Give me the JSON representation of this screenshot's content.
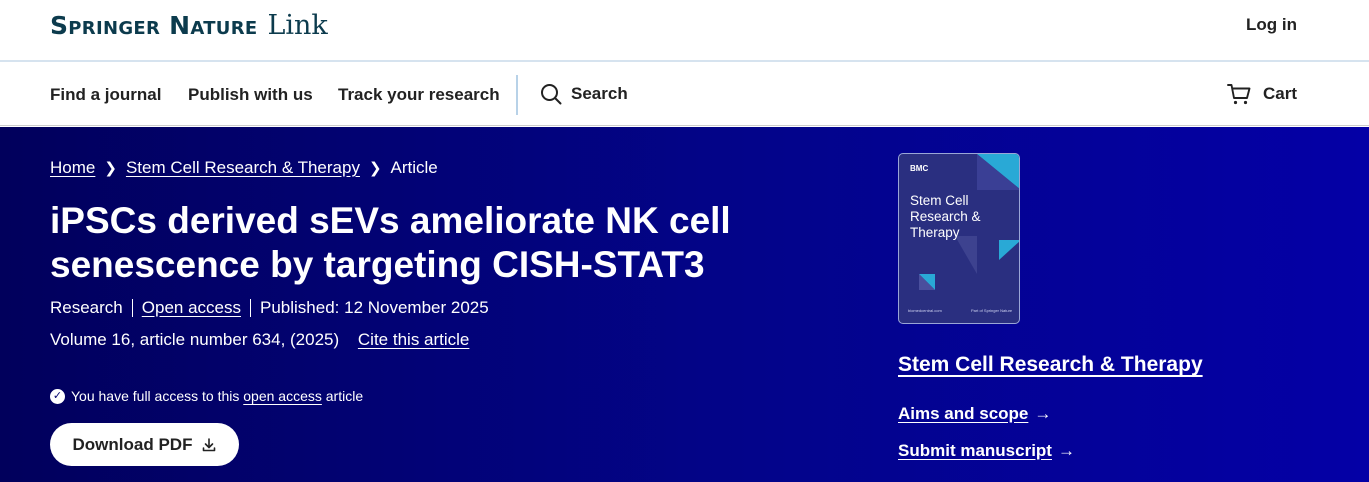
{
  "header": {
    "logo_brand": "Springer Nature",
    "logo_link": "Link",
    "login_label": "Log in"
  },
  "nav": {
    "items": [
      "Find a journal",
      "Publish with us",
      "Track your research"
    ],
    "search_label": "Search",
    "cart_label": "Cart"
  },
  "breadcrumb": {
    "home": "Home",
    "journal": "Stem Cell Research & Therapy",
    "current": "Article"
  },
  "article": {
    "title": "iPSCs derived sEVs ameliorate NK cell senescence by targeting CISH-STAT3",
    "type": "Research",
    "open_access": "Open access",
    "published": "Published: 12 November 2025",
    "volume_info": "Volume 16, article number 634, (2025)",
    "cite_label": "Cite this article",
    "access_prefix": "You have full access to this",
    "access_link": "open access",
    "access_suffix": "article",
    "download_label": "Download PDF"
  },
  "sidebar": {
    "cover": {
      "publisher": "BMC",
      "title": "Stem Cell Research & Therapy",
      "footer_left": "biomedcentral.com",
      "footer_right": "Part of Springer Nature"
    },
    "journal_name": "Stem Cell Research & Therapy",
    "aims_label": "Aims and scope",
    "submit_label": "Submit manuscript"
  },
  "colors": {
    "hero_start": "#01005c",
    "hero_end": "#0400a6",
    "logo": "#0c3b4d",
    "cover_accent": "#29a9d6"
  }
}
